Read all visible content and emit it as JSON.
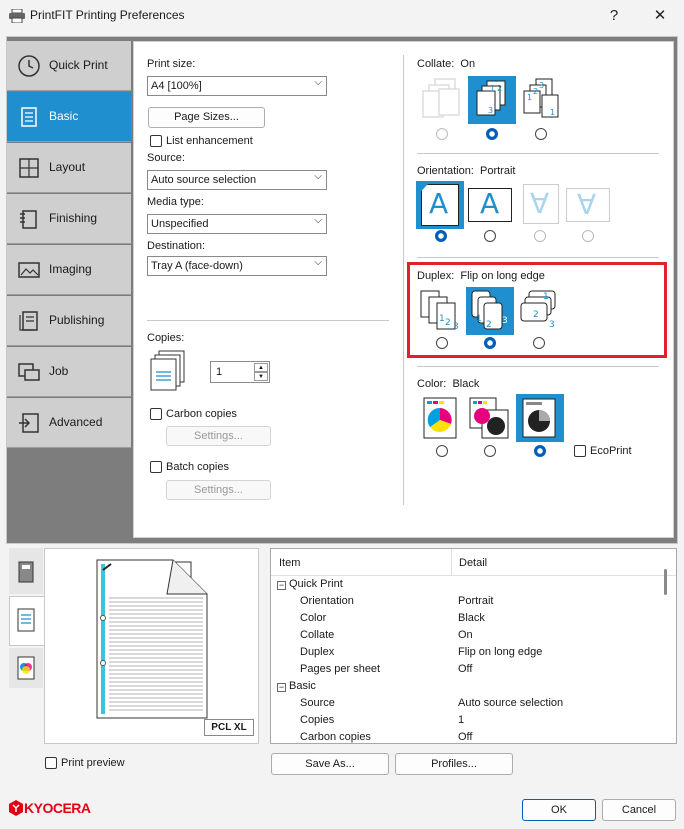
{
  "window": {
    "title": "PrintFIT Printing Preferences",
    "help": "?",
    "close": "✕"
  },
  "sidebar": {
    "items": [
      {
        "label": "Quick Print"
      },
      {
        "label": "Basic"
      },
      {
        "label": "Layout"
      },
      {
        "label": "Finishing"
      },
      {
        "label": "Imaging"
      },
      {
        "label": "Publishing"
      },
      {
        "label": "Job"
      },
      {
        "label": "Advanced"
      }
    ],
    "active": "Basic"
  },
  "basic": {
    "print_size_label": "Print size:",
    "print_size_value": "A4  [100%]",
    "page_sizes_button": "Page Sizes...",
    "list_enhancement": "List enhancement",
    "source_label": "Source:",
    "source_value": "Auto source selection",
    "media_type_label": "Media type:",
    "media_type_value": "Unspecified",
    "destination_label": "Destination:",
    "destination_value": "Tray A (face-down)",
    "copies_label": "Copies:",
    "copies_value": "1",
    "carbon_copies": "Carbon copies",
    "carbon_settings": "Settings...",
    "batch_copies": "Batch copies",
    "batch_settings": "Settings..."
  },
  "collate": {
    "label": "Collate:",
    "value": "On"
  },
  "orientation": {
    "label": "Orientation:",
    "value": "Portrait",
    "glyph": "A"
  },
  "duplex": {
    "label": "Duplex:",
    "value": "Flip on long edge"
  },
  "color": {
    "label": "Color:",
    "value": "Black",
    "ecoprint": "EcoPrint"
  },
  "preview": {
    "badge": "PCL XL",
    "print_preview": "Print preview"
  },
  "summary": {
    "col_item": "Item",
    "col_detail": "Detail",
    "rows": [
      {
        "item": "Quick Print",
        "detail": "",
        "group": true
      },
      {
        "item": "Orientation",
        "detail": "Portrait",
        "group": false
      },
      {
        "item": "Color",
        "detail": "Black",
        "group": false
      },
      {
        "item": "Collate",
        "detail": "On",
        "group": false
      },
      {
        "item": "Duplex",
        "detail": "Flip on long edge",
        "group": false
      },
      {
        "item": "Pages per sheet",
        "detail": "Off",
        "group": false
      },
      {
        "item": "Basic",
        "detail": "",
        "group": true
      },
      {
        "item": "Source",
        "detail": "Auto source selection",
        "group": false
      },
      {
        "item": "Copies",
        "detail": "1",
        "group": false
      },
      {
        "item": "Carbon copies",
        "detail": "Off",
        "group": false
      }
    ]
  },
  "footer": {
    "save_as": "Save As...",
    "profiles": "Profiles...",
    "ok": "OK",
    "cancel": "Cancel",
    "brand": "KYOCERA"
  },
  "colors": {
    "accent": "#1f8fcf",
    "highlight_box": "#e0202a",
    "brand": "#e60012"
  }
}
